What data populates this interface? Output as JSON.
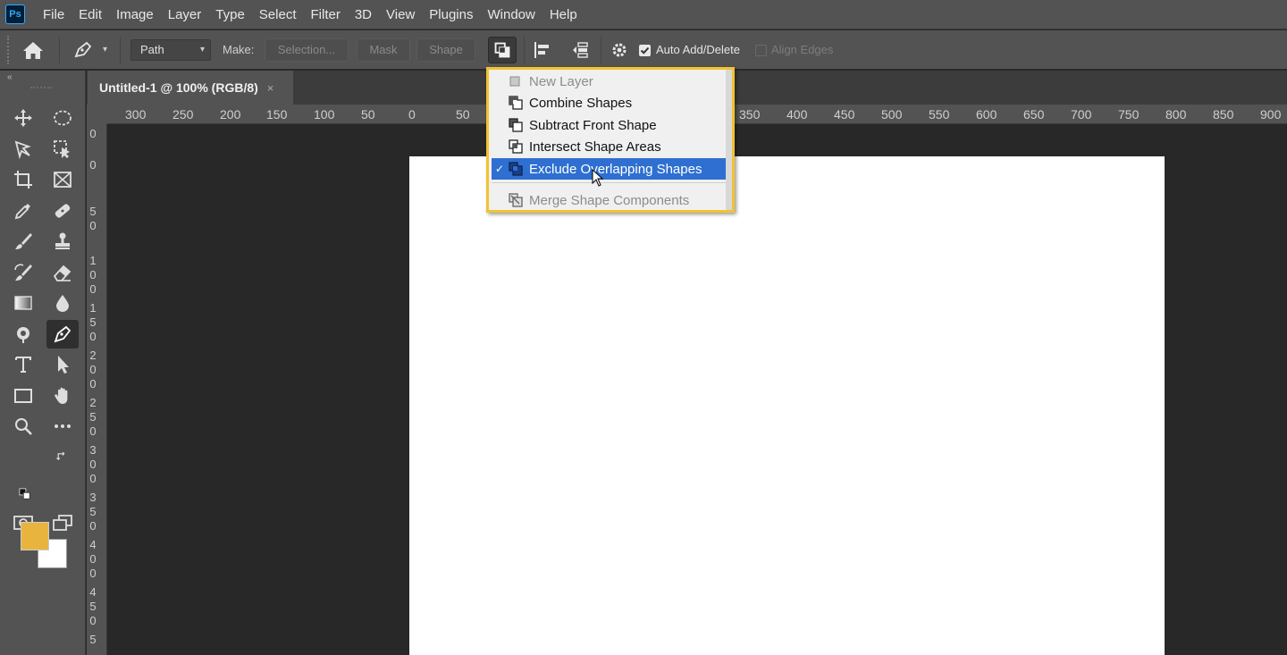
{
  "app": {
    "logo_text": "Ps"
  },
  "menubar": {
    "items": [
      "File",
      "Edit",
      "Image",
      "Layer",
      "Type",
      "Select",
      "Filter",
      "3D",
      "View",
      "Plugins",
      "Window",
      "Help"
    ]
  },
  "options_bar": {
    "path_mode_value": "Path",
    "make_label": "Make:",
    "selection_button": "Selection...",
    "mask_button": "Mask",
    "shape_button": "Shape",
    "auto_add_delete_label": "Auto Add/Delete",
    "auto_add_delete_checked": true,
    "align_edges_label": "Align Edges",
    "align_edges_checked": false
  },
  "document_tab": {
    "title": "Untitled-1 @ 100% (RGB/8)",
    "close_symbol": "×"
  },
  "ruler_h": {
    "labels": [
      "300",
      "250",
      "200",
      "150",
      "100",
      "50",
      "0",
      "50",
      "350",
      "400",
      "450",
      "500",
      "550",
      "600",
      "650",
      "700",
      "750",
      "800",
      "850",
      "900"
    ]
  },
  "ruler_v": {
    "labels": [
      "0",
      "0",
      "5 0",
      "1 0 0",
      "1 5 0",
      "2 0 0",
      "2 5 0",
      "3 0 0",
      "3 5 0",
      "4 0 0",
      "4 5 0",
      "5"
    ]
  },
  "path_operations_menu": {
    "items": [
      {
        "label": "New Layer",
        "icon": "new-layer-icon",
        "state": "disabled",
        "checked": false
      },
      {
        "label": "Combine Shapes",
        "icon": "combine-shapes-icon",
        "state": "normal",
        "checked": false
      },
      {
        "label": "Subtract Front Shape",
        "icon": "subtract-front-shape-icon",
        "state": "normal",
        "checked": false
      },
      {
        "label": "Intersect Shape Areas",
        "icon": "intersect-shape-areas-icon",
        "state": "normal",
        "checked": false
      },
      {
        "label": "Exclude Overlapping Shapes",
        "icon": "exclude-overlapping-shapes-icon",
        "state": "selected",
        "checked": true
      },
      {
        "label": "Merge Shape Components",
        "icon": "merge-shape-components-icon",
        "state": "disabled",
        "checked": false
      }
    ],
    "check_symbol": "✓",
    "highlight_color": "#f2c230"
  },
  "colors": {
    "foreground": "#e8b43e",
    "background": "#ffffff",
    "selection": "#2e6fd1"
  }
}
